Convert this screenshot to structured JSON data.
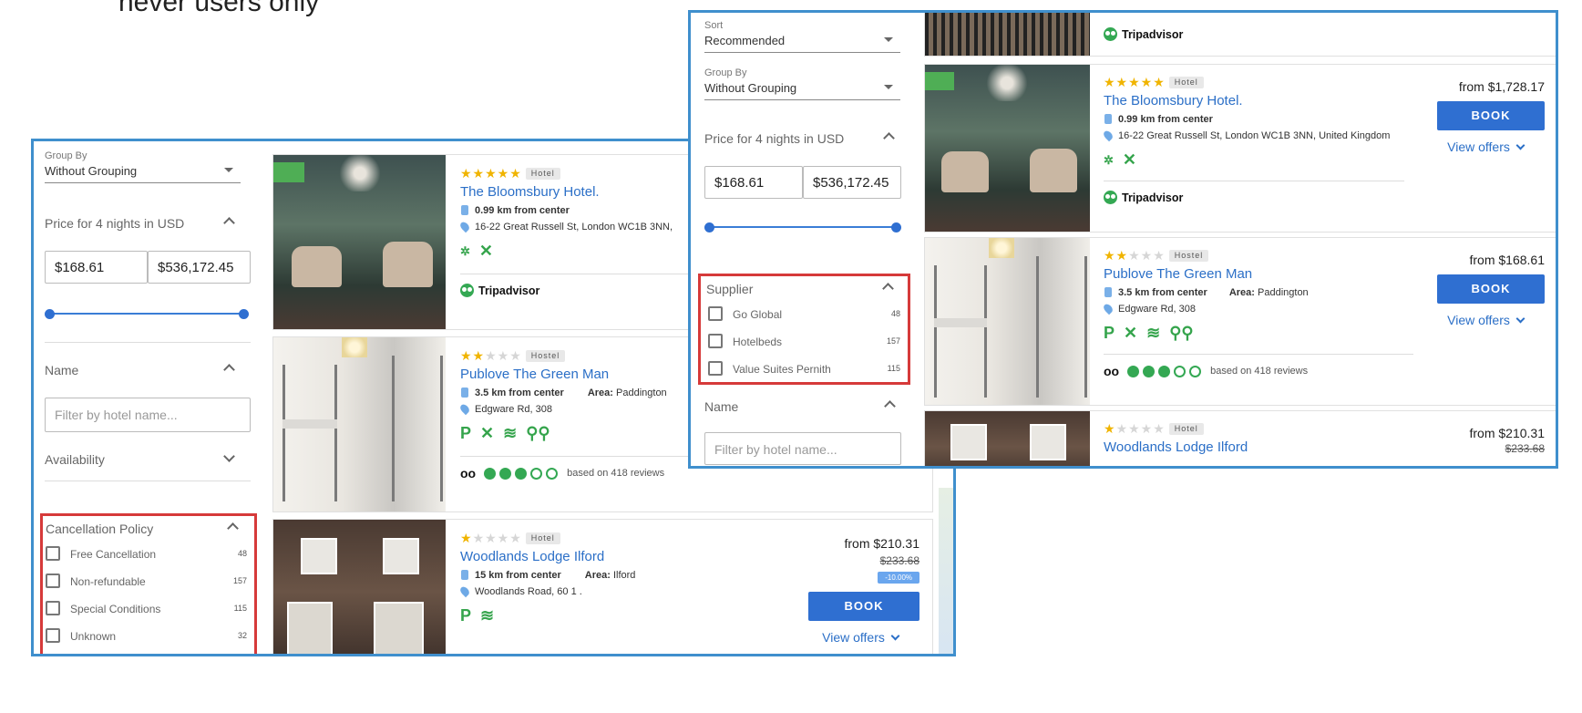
{
  "slide_text": "never users only",
  "left_panel": {
    "group_by_label": "Group By",
    "group_by_value": "Without Grouping",
    "price_title": "Price for 4 nights in USD",
    "price_min": "$168.61",
    "price_max": "$536,172.45",
    "name_title": "Name",
    "name_placeholder": "Filter by hotel name...",
    "availability_title": "Availability",
    "cancel_title": "Cancellation Policy",
    "cancel_options": [
      {
        "label": "Free Cancellation",
        "count": "48"
      },
      {
        "label": "Non-refundable",
        "count": "157"
      },
      {
        "label": "Special Conditions",
        "count": "115"
      },
      {
        "label": "Unknown",
        "count": "32"
      }
    ],
    "hotels": [
      {
        "name": "The Bloomsbury Hotel.",
        "type": "Hotel",
        "stars": 5,
        "distance": "0.99 km from center",
        "address": "16-22 Great Russell St, London WC1B 3NN,",
        "ta_text": "Tripadvisor"
      },
      {
        "name": "Publove The Green Man",
        "type": "Hostel",
        "stars": 2,
        "distance": "3.5 km from center",
        "area_label": "Area:",
        "area": "Paddington",
        "address": "Edgware Rd, 308",
        "reviews": "based on 418 reviews"
      },
      {
        "name": "Woodlands Lodge Ilford",
        "type": "Hotel",
        "stars": 1,
        "distance": "15 km from center",
        "area_label": "Area:",
        "area": "Ilford",
        "address": "Woodlands Road, 60 1 .",
        "price_from": "from $210.31",
        "price_old": "$233.68",
        "discount": "-10.00%",
        "book": "BOOK",
        "view_offers": "View offers"
      }
    ]
  },
  "right_panel": {
    "sort_label": "Sort",
    "sort_value": "Recommended",
    "group_by_label": "Group By",
    "group_by_value": "Without Grouping",
    "price_title": "Price for 4 nights in USD",
    "price_min": "$168.61",
    "price_max": "$536,172.45",
    "supplier_title": "Supplier",
    "supplier_options": [
      {
        "label": "Go Global",
        "count": "48"
      },
      {
        "label": "Hotelbeds",
        "count": "157"
      },
      {
        "label": "Value Suites Pernith",
        "count": "115"
      }
    ],
    "name_title": "Name",
    "name_placeholder": "Filter by hotel name...",
    "top_ta": "Tripadvisor",
    "hotels": [
      {
        "name": "The Bloomsbury Hotel.",
        "type": "Hotel",
        "stars": 5,
        "distance": "0.99 km from center",
        "address": "16-22 Great Russell St, London WC1B 3NN, United Kingdom",
        "ta_text": "Tripadvisor",
        "price_from": "from $1,728.17",
        "book": "BOOK",
        "view_offers": "View offers"
      },
      {
        "name": "Publove The Green Man",
        "type": "Hostel",
        "stars": 2,
        "distance": "3.5 km from center",
        "area_label": "Area:",
        "area": "Paddington",
        "address": "Edgware Rd, 308",
        "reviews": "based on 418 reviews",
        "price_from": "from $168.61",
        "book": "BOOK",
        "view_offers": "View offers"
      },
      {
        "name": "Woodlands Lodge Ilford",
        "type": "Hotel",
        "stars": 1,
        "price_from": "from $210.31",
        "price_old": "$233.68"
      }
    ]
  },
  "colors": {
    "frame": "#3f8fcd",
    "highlight": "#d63a3a",
    "accent": "#2f6fd1",
    "amenity": "#35a44c",
    "star": "#f0b400"
  }
}
